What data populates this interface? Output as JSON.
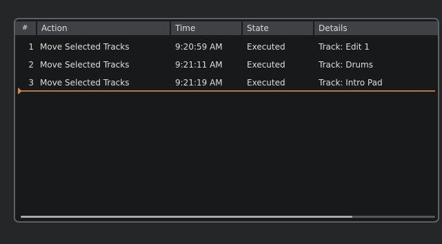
{
  "columns": {
    "num": "#",
    "action": "Action",
    "time": "Time",
    "state": "State",
    "details": "Details"
  },
  "rows": [
    {
      "num": "1",
      "action": "Move Selected Tracks",
      "time": "9:20:59 AM",
      "state": "Executed",
      "details": "Track: Edit 1"
    },
    {
      "num": "2",
      "action": "Move Selected Tracks",
      "time": "9:21:11 AM",
      "state": "Executed",
      "details": "Track: Drums"
    },
    {
      "num": "3",
      "action": "Move Selected Tracks",
      "time": "9:21:19 AM",
      "state": "Executed",
      "details": "Track: Intro Pad"
    }
  ],
  "scrollbar": {
    "thumb_fraction": 0.8
  },
  "colors": {
    "cursor": "#c07a3e",
    "header_bg": "#3e4146",
    "panel_bg": "#18191b"
  },
  "icons": {
    "cursor_marker": "play-triangle-icon"
  }
}
